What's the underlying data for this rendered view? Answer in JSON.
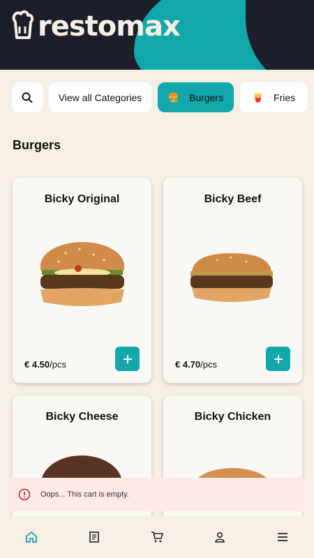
{
  "app": {
    "brand": "restomax",
    "accent_color": "#11a7ab",
    "header_color": "#1b1f2a"
  },
  "categories": {
    "search_icon": "search-icon",
    "items": [
      {
        "label": "View all Categories",
        "emoji": ""
      },
      {
        "label": "Burgers",
        "emoji": "🍔",
        "active": true
      },
      {
        "label": "Fries",
        "emoji": "🍟"
      }
    ]
  },
  "section": {
    "title": "Burgers"
  },
  "products": [
    {
      "name": "Bicky Original",
      "price": "€ 4.50",
      "unit": "/pcs"
    },
    {
      "name": "Bicky Beef",
      "price": "€ 4.70",
      "unit": "/pcs"
    },
    {
      "name": "Bicky Cheese"
    },
    {
      "name": "Bicky Chicken"
    }
  ],
  "toast": {
    "message": "Oops... This cart is empty.",
    "icon": "error-circle-icon"
  },
  "nav": {
    "items": [
      "home-icon",
      "receipt-icon",
      "cart-icon",
      "user-icon",
      "menu-icon"
    ]
  }
}
